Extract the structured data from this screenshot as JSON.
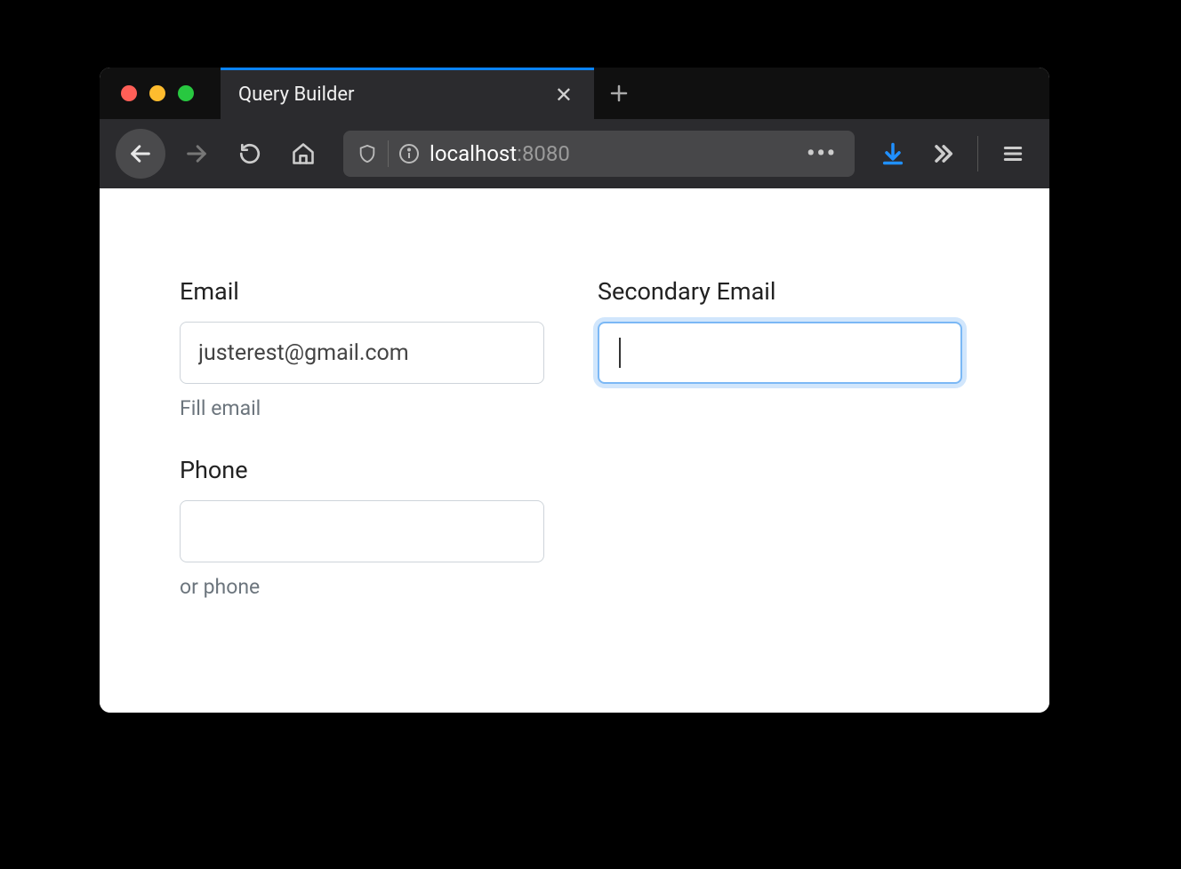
{
  "browser": {
    "tab": {
      "title": "Query Builder"
    },
    "address": {
      "host": "localhost",
      "port": ":8080"
    }
  },
  "form": {
    "email": {
      "label": "Email",
      "value": "justerest@gmail.com",
      "hint": "Fill email"
    },
    "phone": {
      "label": "Phone",
      "value": "",
      "hint": "or phone"
    },
    "secondary_email": {
      "label": "Secondary Email",
      "value": ""
    }
  }
}
